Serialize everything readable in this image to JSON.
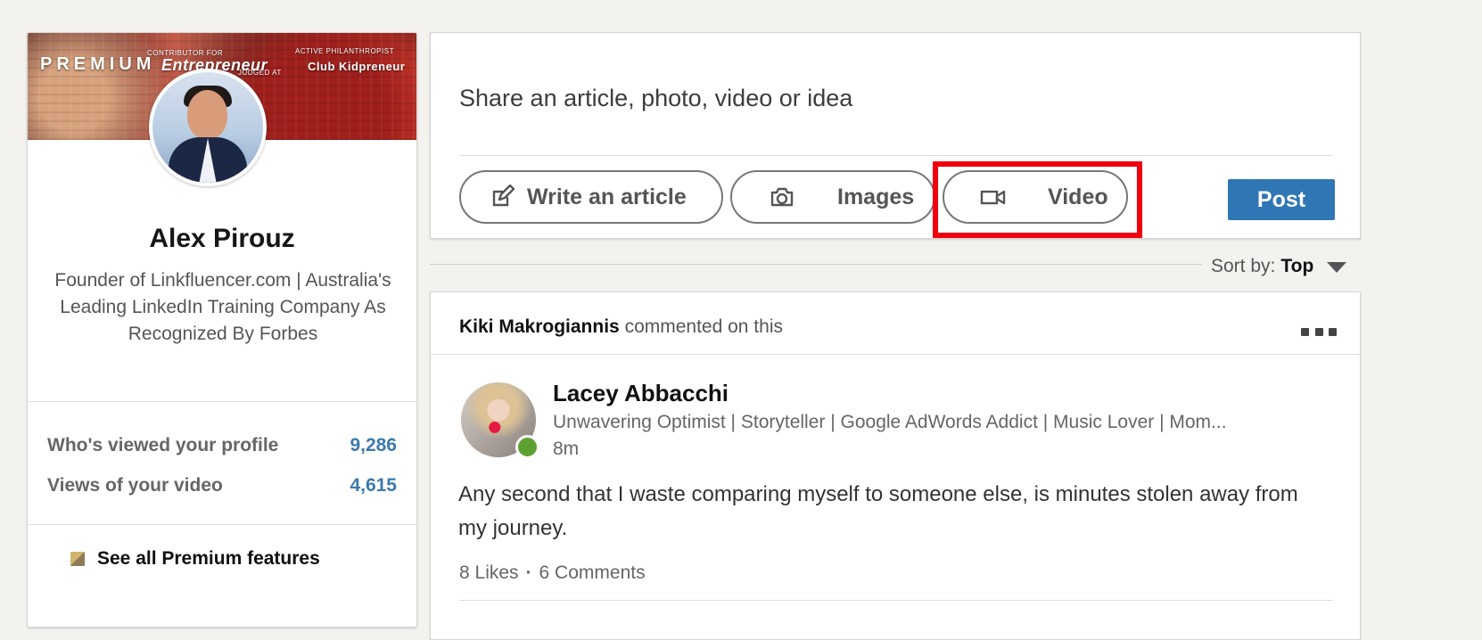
{
  "top_banner": {
    "text": "···"
  },
  "profile": {
    "cover": {
      "premium_label": "PREMIUM",
      "tags": [
        "CONTRIBUTOR FOR",
        "Entrepreneur",
        "JUDGED AT",
        "ACTIVE PHILANTHROPIST",
        "Club Kidpreneur"
      ]
    },
    "name": "Alex Pirouz",
    "headline": "Founder of Linkfluencer.com | Australia's Leading LinkedIn Training Company As Recognized By Forbes",
    "stats": [
      {
        "label": "Who's viewed your profile",
        "value": "9,286"
      },
      {
        "label": "Views of your video",
        "value": "4,615"
      }
    ],
    "premium_features_label": "See all Premium features"
  },
  "composer": {
    "prompt": "Share an article, photo, video or idea",
    "actions": [
      {
        "label": "Write an article",
        "icon": "edit-icon"
      },
      {
        "label": "Images",
        "icon": "camera-icon"
      },
      {
        "label": "Video",
        "icon": "video-camera-icon"
      }
    ],
    "post_label": "Post",
    "highlight_color": "#f0000f",
    "post_color": "#2f76b4"
  },
  "sort": {
    "label": "Sort by:",
    "value": "Top"
  },
  "feed_item": {
    "actor": "Kiki Makrogiannis",
    "activity": "commented on this",
    "author": {
      "name": "Lacey Abbacchi",
      "headline": "Unwavering Optimist | Storyteller | Google AdWords Addict | Music Lover | Mom..."
    },
    "time": "8m",
    "body": "Any second that I waste comparing myself to someone else, is minutes stolen away from my journey.",
    "likes": "8 Likes",
    "separator": "·",
    "comments": "6 Comments"
  }
}
